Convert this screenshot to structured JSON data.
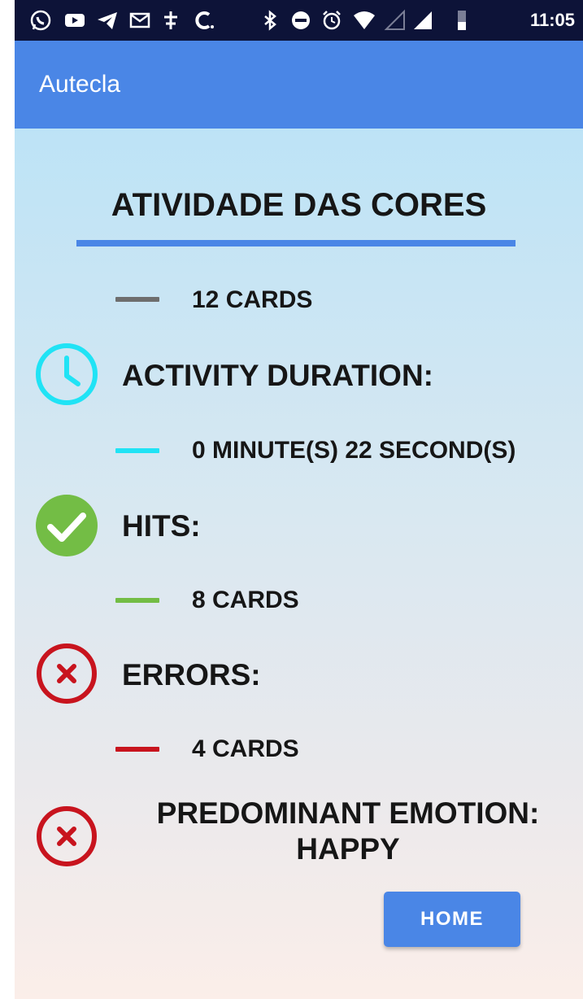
{
  "status_bar": {
    "time": "11:05",
    "left_icons": [
      "whatsapp-icon",
      "youtube-icon",
      "telegram-icon",
      "gmail-icon",
      "app-icon",
      "c-app-icon"
    ],
    "right_icons": [
      "bluetooth-icon",
      "do-not-disturb-icon",
      "alarm-icon",
      "wifi-icon",
      "signal-icon",
      "signal-icon",
      "battery-icon"
    ]
  },
  "app_bar": {
    "title": "Autecla",
    "color": "#4a86e6"
  },
  "activity": {
    "title": "ATIVIDADE DAS CORES",
    "total_cards": "12 CARDS",
    "duration_label": "ACTIVITY DURATION:",
    "duration_value": "0 MINUTE(S) 22 SECOND(S)",
    "hits_label": "HITS:",
    "hits_value": "8 CARDS",
    "errors_label": "ERRORS:",
    "errors_value": "4 CARDS",
    "emotion_line1": "PREDOMINANT EMOTION:",
    "emotion_line2": "HAPPY"
  },
  "icons": {
    "duration": "clock-icon",
    "hits": "check-circle-icon",
    "errors": "x-circle-icon",
    "emotion": "x-circle-icon"
  },
  "colors": {
    "total": "#6e6e6e",
    "duration": "#20e3f5",
    "hits": "#73bd45",
    "errors": "#c8141e",
    "accent": "#4a86e6"
  },
  "buttons": {
    "home": "HOME"
  }
}
